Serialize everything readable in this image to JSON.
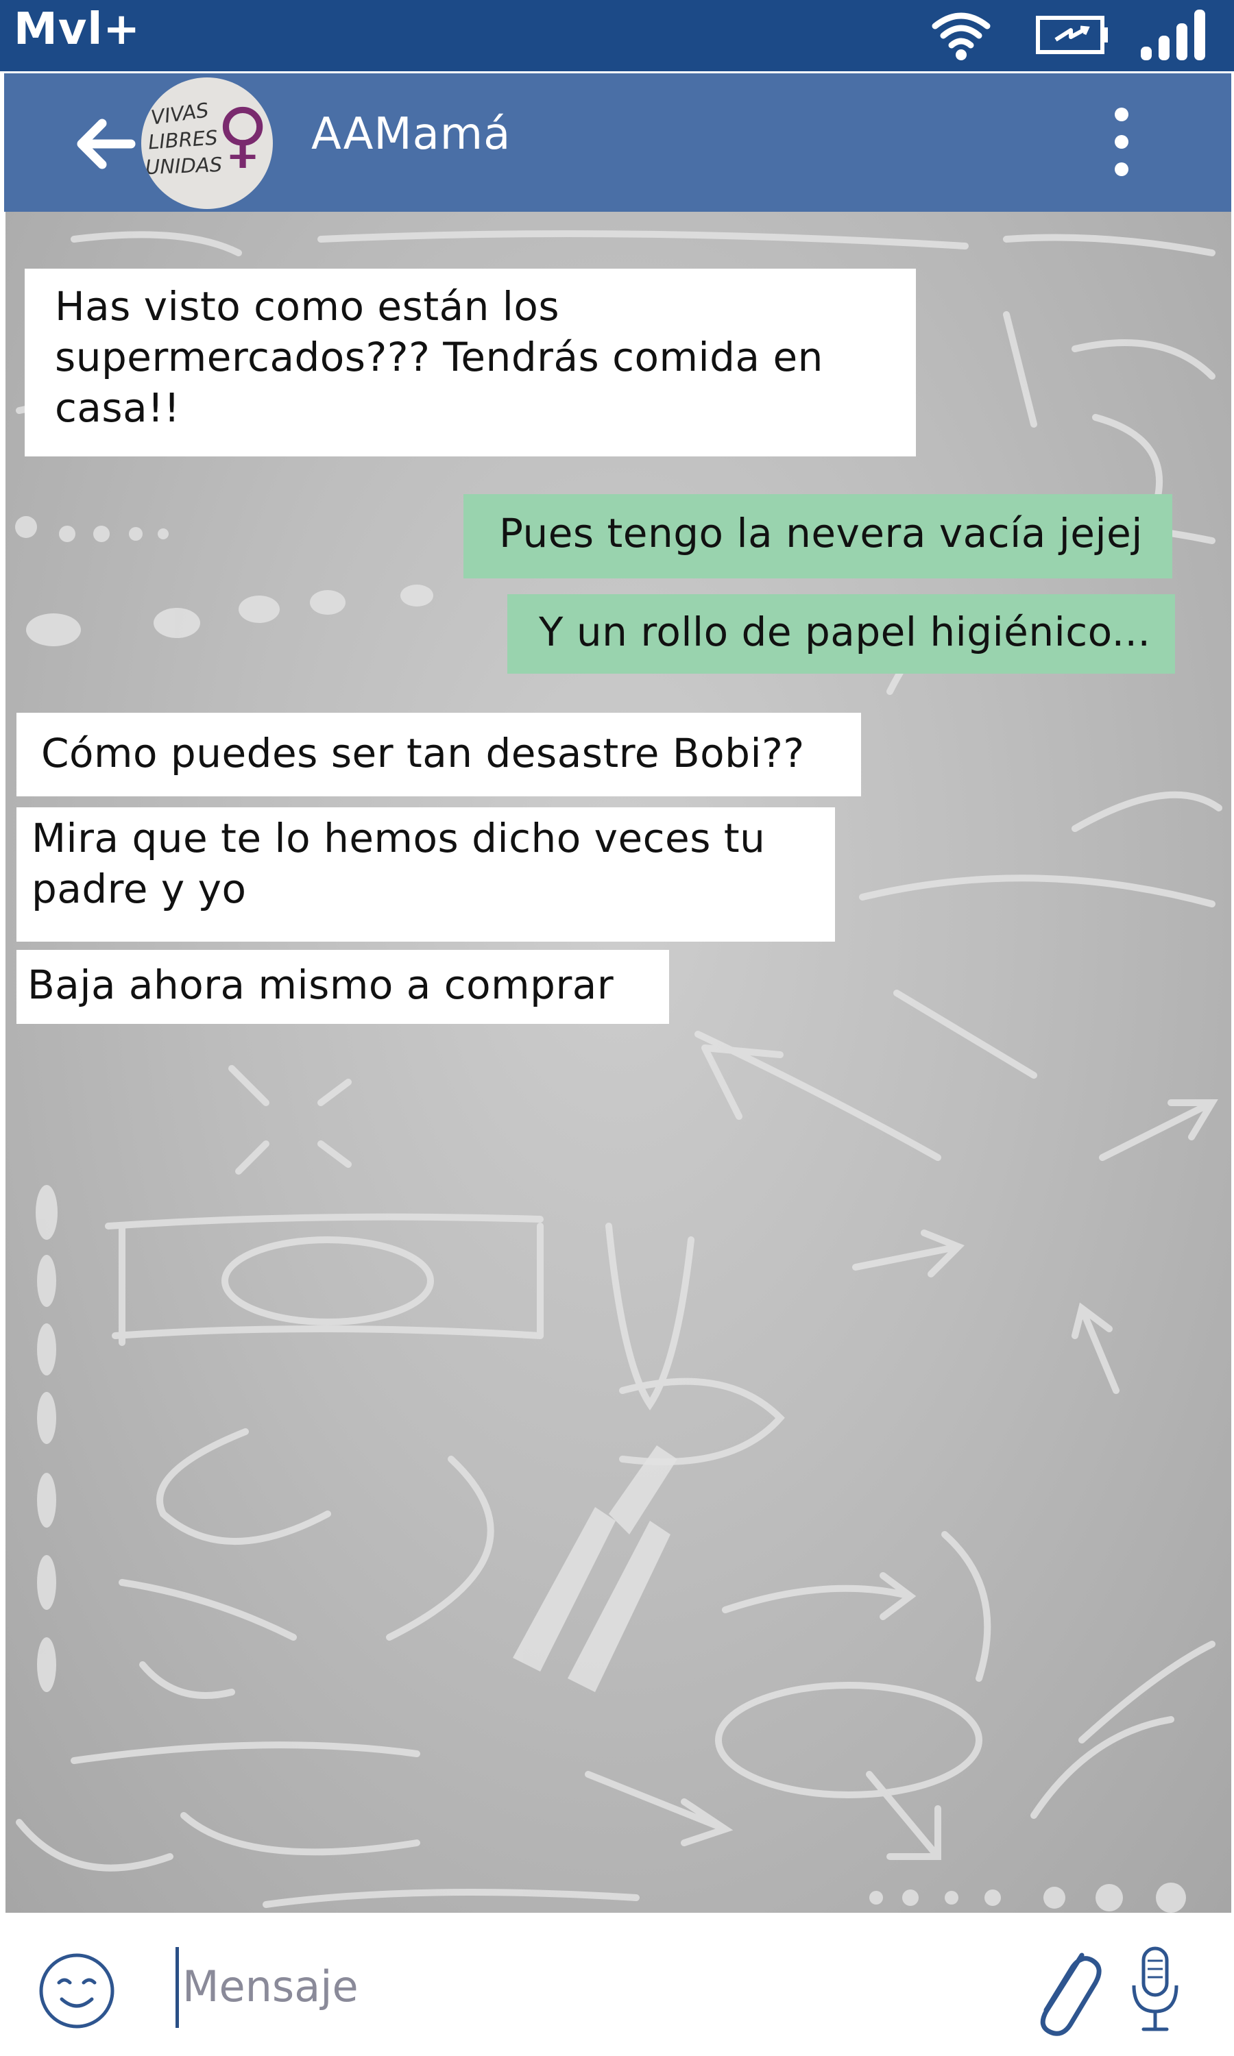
{
  "status_bar": {
    "carrier": "Mvl+",
    "icons": [
      "wifi-icon",
      "battery-charging-icon",
      "signal-icon"
    ]
  },
  "header": {
    "back_icon": "arrow-left-icon",
    "avatar_lines": [
      "VIVAS",
      "LIBRES",
      "UNIDAS"
    ],
    "avatar_symbol": "♀",
    "contact_name": "AAMamá",
    "menu_icon": "more-vert-icon"
  },
  "messages": [
    {
      "direction": "in",
      "text": "Has visto como están los supermercados??? Tendrás comida en casa!!"
    },
    {
      "direction": "out",
      "text": "Pues tengo la nevera vacía jejej"
    },
    {
      "direction": "out",
      "text": "Y un rollo de papel higiénico..."
    },
    {
      "direction": "in",
      "text": "Cómo puedes ser tan desastre Bobi??"
    },
    {
      "direction": "in",
      "text": "Mira que te lo hemos dicho veces tu padre y yo"
    },
    {
      "direction": "in",
      "text": "Baja ahora mismo a comprar"
    }
  ],
  "composer": {
    "placeholder": "Mensaje",
    "emoji_icon": "smiley-icon",
    "attach_icon": "paperclip-icon",
    "mic_icon": "microphone-icon"
  },
  "colors": {
    "status_bar": "#1c4a87",
    "header": "#4a6fa6",
    "outgoing_bubble": "#99d3ae",
    "incoming_bubble": "#ffffff",
    "chat_background": "#bdbdbd",
    "avatar_symbol": "#7a2a6e"
  }
}
